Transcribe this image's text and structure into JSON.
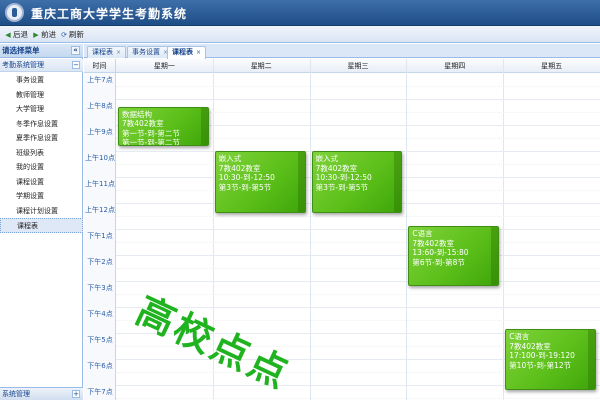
{
  "app": {
    "title": "重庆工商大学学生考勤系统"
  },
  "toolbar": {
    "back": "后退",
    "forward": "前进",
    "refresh": "刷新"
  },
  "sidebar": {
    "title": "请选择菜单",
    "collapse_symbol": "«",
    "group": {
      "label": "考勤系统管理",
      "toggle": "−"
    },
    "items": [
      {
        "label": "事务设置"
      },
      {
        "label": "教师管理"
      },
      {
        "label": "大学管理"
      },
      {
        "label": "冬季作息设置"
      },
      {
        "label": "夏季作息设置"
      },
      {
        "label": "班级列表"
      },
      {
        "label": "我的设置"
      },
      {
        "label": "课程设置"
      },
      {
        "label": "学期设置"
      },
      {
        "label": "课程计划设置"
      },
      {
        "label": "课程表"
      }
    ],
    "active_index": 10,
    "footer": {
      "label": "系统管理",
      "toggle": "+"
    }
  },
  "tabs": [
    {
      "label": "课程表",
      "close": "×"
    },
    {
      "label": "事务设置",
      "close": "×"
    },
    {
      "label": "课程表",
      "close": "×",
      "active": true
    }
  ],
  "schedule": {
    "time_header": "时间",
    "days": [
      "星期一",
      "星期二",
      "星期三",
      "星期四",
      "星期五"
    ],
    "times": [
      "上午7点",
      "上午8点",
      "上午9点",
      "上午10点",
      "上午11点",
      "上午12点",
      "下午1点",
      "下午2点",
      "下午3点",
      "下午4点",
      "下午5点",
      "下午6点",
      "下午7点"
    ],
    "events": [
      {
        "day": 0,
        "start_hour": 8.3,
        "end_hour": 9.8,
        "name": "数据结构",
        "room": "7教402教室",
        "time": "第一节-到-第二节",
        "periods": "第一节-到-第二节"
      },
      {
        "day": 1,
        "start_hour": 10.0,
        "end_hour": 12.4,
        "name": "嵌入式",
        "room": "7教402教室",
        "time": "10:30-到-12:50",
        "periods": "第3节-到-第5节"
      },
      {
        "day": 2,
        "start_hour": 10.0,
        "end_hour": 12.4,
        "name": "嵌入式",
        "room": "7教402教室",
        "time": "10:30-到-12:50",
        "periods": "第3节-到-第5节"
      },
      {
        "day": 3,
        "start_hour": 12.9,
        "end_hour": 15.2,
        "name": "C语言",
        "room": "7教402教室",
        "time": "13:60-到-15:80",
        "periods": "第6节-到-第8节"
      },
      {
        "day": 4,
        "start_hour": 16.85,
        "end_hour": 19.2,
        "name": "C语言",
        "room": "7教402教室",
        "time": "17:100-到-19:120",
        "periods": "第10节-到-第12节"
      }
    ]
  },
  "watermark": "高校点点",
  "colors": {
    "header": "#1e4d86",
    "event_green": "#5cbf1a",
    "watermark": "#1fb31f"
  }
}
